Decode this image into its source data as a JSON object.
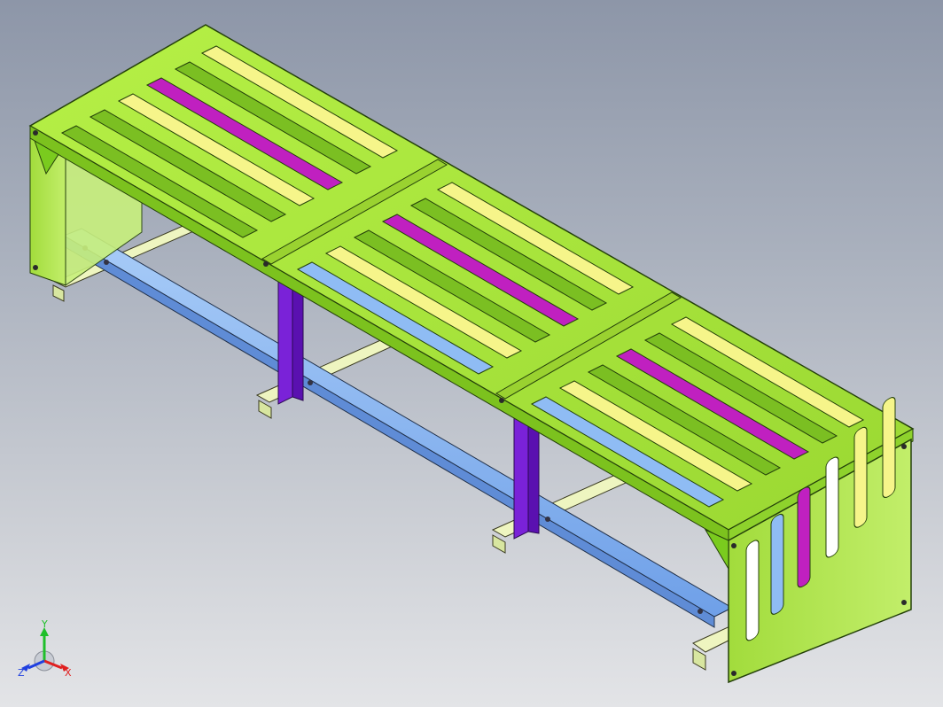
{
  "viewport": {
    "background_top": "#8d96a8",
    "background_bottom": "#e3e4e7"
  },
  "model": {
    "description_colors": {
      "frame_green": "#a8e63c",
      "frame_green_dark": "#6fa81e",
      "slat_yellow": "#f6f58a",
      "slat_magenta": "#c020c0",
      "beam_blue": "#8fbcf4",
      "post_purple": "#7a22d8",
      "rail_pale": "#e6f0b0"
    }
  },
  "triad": {
    "y_label": "Y",
    "x_label": "X",
    "z_label": "Z",
    "y_color": "#1fbf2a",
    "x_color": "#e02020",
    "z_color": "#2040e0"
  }
}
